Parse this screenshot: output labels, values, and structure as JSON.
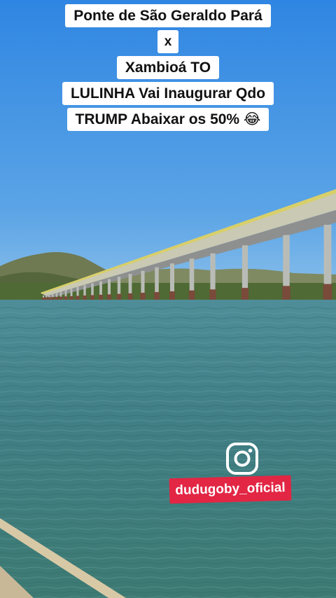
{
  "caption": {
    "lines": [
      "Ponte de São Geraldo Pará",
      "x",
      "Xambioá TO",
      "LULINHA Vai Inaugurar Qdo",
      "TRUMP Abaixar os 50% 😂"
    ]
  },
  "watermark": {
    "icon": "instagram-icon",
    "handle": "dudugoby_oficial",
    "badge_color": "#e22644"
  },
  "scene": {
    "sky_color": "#4a96e0",
    "water_color": "#3f7f86",
    "bridge_deck_color": "#d8cf6a"
  }
}
